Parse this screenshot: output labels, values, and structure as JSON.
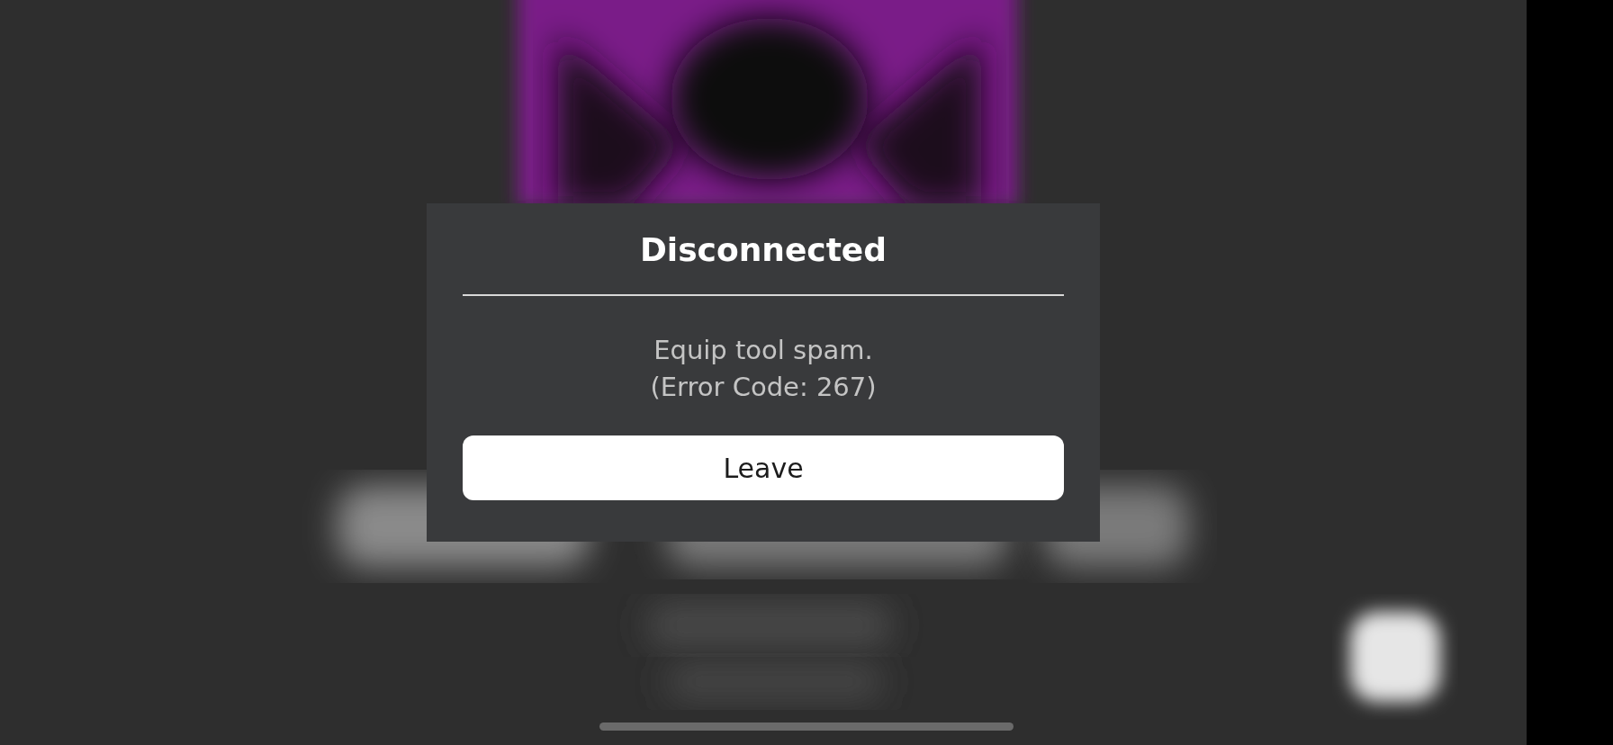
{
  "dialog": {
    "title": "Disconnected",
    "message": [
      "Equip tool spam.",
      "(Error Code: 267)"
    ],
    "button": "Leave"
  },
  "home_indicator": {
    "kind": "bar"
  }
}
